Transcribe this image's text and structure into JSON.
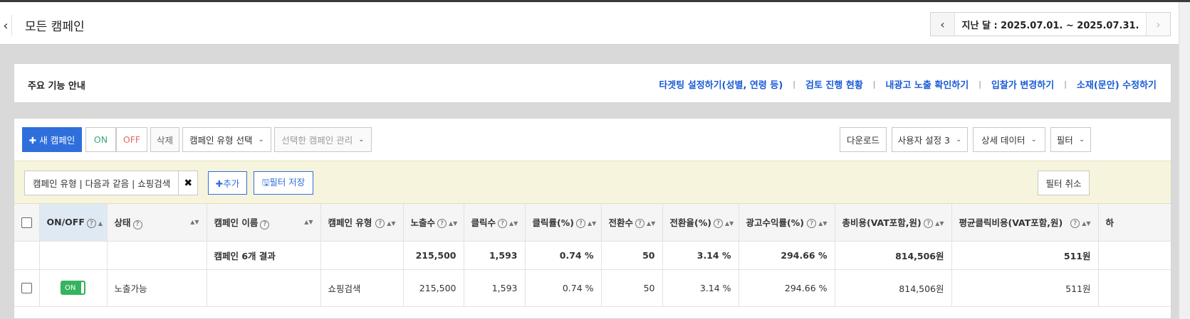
{
  "header": {
    "back_icon": "chevron-left-icon",
    "title": "모든 캠페인",
    "date_range": "지난 달 : 2025.07.01. ~ 2025.07.31.",
    "prev_icon": "‹",
    "next_icon": "›"
  },
  "guide": {
    "title": "주요 기능 안내",
    "links": [
      "타겟팅 설정하기(성별, 연령 등)",
      "검토 진행 현황",
      "내광고 노출 확인하기",
      "입찰가 변경하기",
      "소재(문안) 수정하기"
    ],
    "separator": "|"
  },
  "toolbar": {
    "new_campaign": "✚ 새 캠페인",
    "on": "ON",
    "off": "OFF",
    "delete": "삭제",
    "campaign_type_select": "캠페인 유형 선택",
    "manage_selected": "선택한 캠페인 관리",
    "download": "다운로드",
    "user_setting": "사용자 설정 3",
    "detail_data": "상세 데이터",
    "filter": "필터",
    "caret": "⌄"
  },
  "filterbar": {
    "chip_text": "캠페인 유형 | 다음과 같음 | 쇼핑검색",
    "chip_remove": "✖",
    "add": "✚추가",
    "save": "🖫필터 저장",
    "cancel": "필터 취소"
  },
  "table": {
    "headers": [
      "ON/OFF",
      "상태",
      "캠페인 이름",
      "캠페인 유형",
      "노출수",
      "클릭수",
      "클릭률(%)",
      "전환수",
      "전환율(%)",
      "광고수익률(%)",
      "총비용(VAT포함,원)",
      "평균클릭비용(VAT포함,원)",
      "하"
    ],
    "summary": {
      "label": "캠페인 6개 결과",
      "impressions": "215,500",
      "clicks": "1,593",
      "ctr": "0.74 %",
      "conversions": "50",
      "cvr": "3.14 %",
      "roas": "294.66 %",
      "cost": "814,506원",
      "cpc": "511원"
    },
    "rows": [
      {
        "toggle": "ON",
        "status": "노출가능",
        "name": "",
        "type": "쇼핑검색",
        "impressions": "215,500",
        "clicks": "1,593",
        "ctr": "0.74 %",
        "conversions": "50",
        "cvr": "3.14 %",
        "roas": "294.66 %",
        "cost": "814,506원",
        "cpc": "511원"
      }
    ]
  },
  "icons": {
    "help": "?",
    "sort": "▲▼",
    "sort_active": "▲"
  },
  "colors": {
    "primary": "#2e6fdc",
    "link": "#1a5bd6",
    "toggle_on": "#36b35e",
    "filter_bg": "#f6f4dc"
  }
}
